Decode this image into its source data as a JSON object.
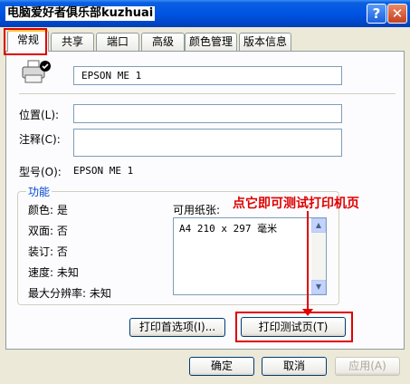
{
  "window": {
    "title": "电脑爱好者俱乐部kuzhuai",
    "help_label": "?",
    "close_label": "✕"
  },
  "tabs": [
    "常规",
    "共享",
    "端口",
    "高级",
    "颜色管理",
    "版本信息"
  ],
  "general": {
    "printer_name": "EPSON ME 1",
    "location_label": "位置(L):",
    "location_value": "",
    "comment_label": "注释(C):",
    "comment_value": "",
    "model_label": "型号(O):",
    "model_value": "EPSON ME 1"
  },
  "features": {
    "title": "功能",
    "color": "颜色: 是",
    "duplex": "双面: 否",
    "staple": "装订: 否",
    "speed": "速度: 未知",
    "max_resolution": "最大分辨率: 未知",
    "paper_label": "可用纸张:",
    "paper_list": [
      "A4 210 x 297 毫米"
    ]
  },
  "buttons": {
    "preferences": "打印首选项(I)...",
    "print_test": "打印测试页(T)",
    "ok": "确定",
    "cancel": "取消",
    "apply": "应用(A)"
  },
  "annotation": "点它即可测试打印机页",
  "colors": {
    "annotation_red": "#E00000",
    "titlebar_blue": "#0054E3",
    "dialog_bg": "#ECE9D8"
  }
}
